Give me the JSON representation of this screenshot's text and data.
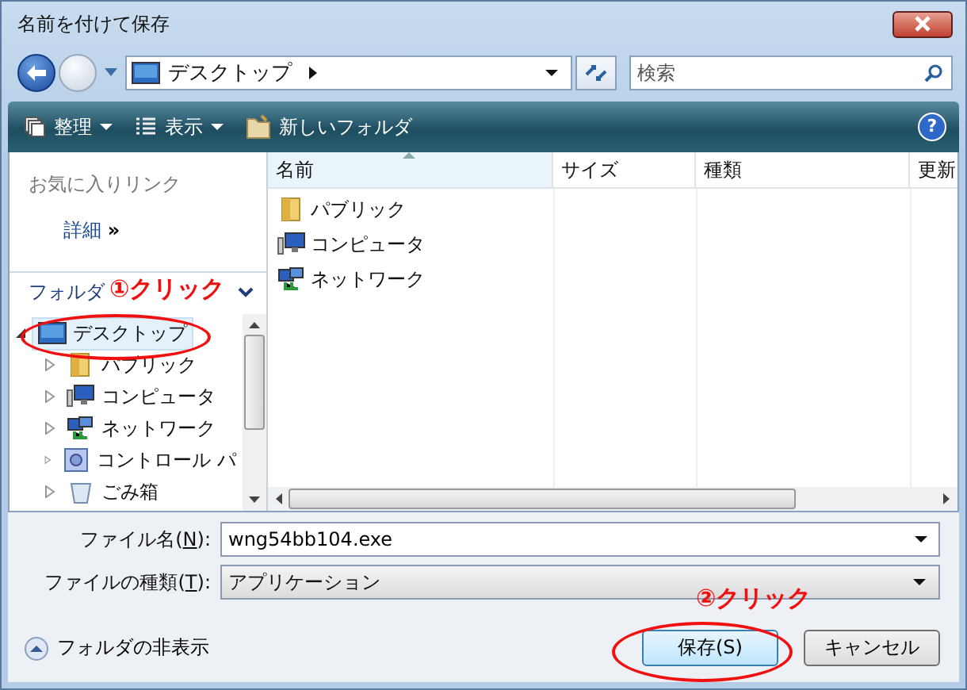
{
  "window": {
    "title": "名前を付けて保存"
  },
  "address": {
    "path": "デスクトップ"
  },
  "search": {
    "placeholder": "検索"
  },
  "toolbar": [
    {
      "label": "整理",
      "kind": "organize",
      "dropdown": true
    },
    {
      "label": "表示",
      "kind": "views",
      "dropdown": true
    },
    {
      "label": "新しいフォルダ",
      "kind": "new-folder",
      "dropdown": false
    }
  ],
  "favorites": {
    "title": "お気に入りリンク",
    "more": "詳細",
    "more_mark": "»"
  },
  "help": "?",
  "folders": {
    "title": "フォルダ",
    "tree": [
      {
        "label": "デスクトップ",
        "kind": "desktop",
        "expanded": true,
        "selected": true,
        "children": [
          {
            "label": "パブリック",
            "kind": "folder",
            "expanded": false,
            "selected": false
          },
          {
            "label": "コンピュータ",
            "kind": "computer",
            "expanded": false,
            "selected": false
          },
          {
            "label": "ネットワーク",
            "kind": "network",
            "expanded": false,
            "selected": false
          },
          {
            "label": "コントロール パ",
            "kind": "control-panel",
            "expanded": false,
            "selected": false
          },
          {
            "label": "ごみ箱",
            "kind": "trash",
            "expanded": false,
            "selected": false
          }
        ]
      }
    ]
  },
  "table": {
    "columns": [
      {
        "label": "名前",
        "sorted": true
      },
      {
        "label": "サイズ",
        "sorted": false
      },
      {
        "label": "種類",
        "sorted": false
      },
      {
        "label": "更新",
        "sorted": false
      }
    ],
    "rows": [
      {
        "name": "パブリック",
        "kind": "folder"
      },
      {
        "name": "コンピュータ",
        "kind": "computer"
      },
      {
        "name": "ネットワーク",
        "kind": "network"
      }
    ]
  },
  "file_name": {
    "label": "ファイル名(",
    "accesskey": "N",
    "label_end": "):",
    "value": "wng54bb104.exe"
  },
  "file_type": {
    "label": "ファイルの種類(",
    "accesskey": "T",
    "label_end": "):",
    "value": "アプリケーション"
  },
  "hide_folders": "フォルダの非表示",
  "buttons": [
    {
      "label": "保存(S)",
      "default": true
    },
    {
      "label": "キャンセル",
      "default": false
    }
  ],
  "annotations": [
    "①クリック",
    "②クリック"
  ]
}
